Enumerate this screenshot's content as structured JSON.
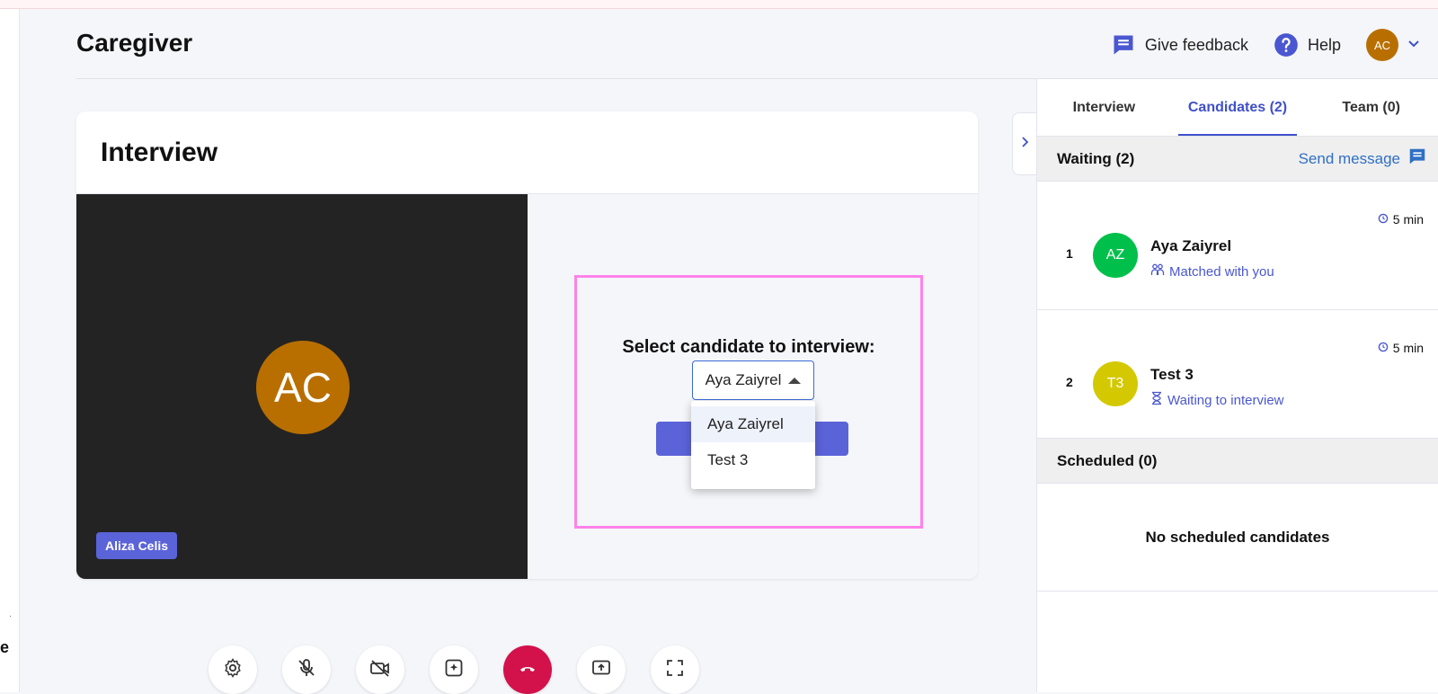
{
  "app": {
    "page_title": "Caregiver",
    "rail_fragment": "e"
  },
  "header": {
    "feedback_label": "Give feedback",
    "help_label": "Help",
    "user_initials": "AC"
  },
  "interview_card": {
    "title": "Interview",
    "self_initials": "AC",
    "self_name": "Aliza Celis",
    "select_label": "Select candidate to interview:",
    "selected_candidate": "Aya Zaiyrel",
    "options": [
      "Aya Zaiyrel",
      "Test 3"
    ]
  },
  "side_panel": {
    "tabs": [
      "Interview",
      "Candidates (2)",
      "Team (0)"
    ],
    "active_tab": "Candidates (2)",
    "waiting_title": "Waiting (2)",
    "send_message_label": "Send message",
    "candidates": [
      {
        "index": "1",
        "initials": "AZ",
        "name": "Aya Zaiyrel",
        "status": "Matched with you",
        "wait": "5 min",
        "color": "#00c04b"
      },
      {
        "index": "2",
        "initials": "T3",
        "name": "Test 3",
        "status": "Waiting to interview",
        "wait": "5 min",
        "color": "#d4c900"
      }
    ],
    "scheduled_title": "Scheduled (0)",
    "scheduled_empty": "No scheduled candidates"
  },
  "colors": {
    "accent": "#5b63d8",
    "link": "#2f6fc4",
    "end_call": "#d3114a",
    "user_avatar": "#b86f00"
  },
  "icons": [
    "feedback-icon",
    "help-icon",
    "chevron-down-icon",
    "chevron-right-icon",
    "settings-icon",
    "mic-off-icon",
    "camera-off-icon",
    "effects-icon",
    "end-call-icon",
    "share-screen-icon",
    "fullscreen-icon",
    "clock-icon",
    "match-icon",
    "hourglass-icon",
    "message-icon"
  ]
}
